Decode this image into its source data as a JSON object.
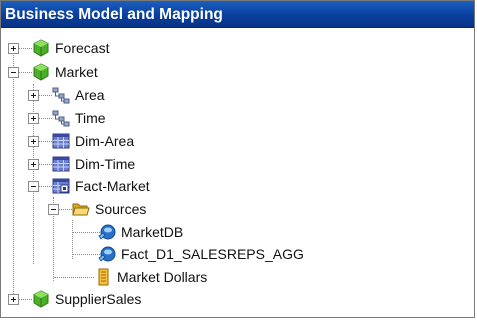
{
  "panel": {
    "title": "Business Model and Mapping"
  },
  "tree": {
    "forecast": "Forecast",
    "market": "Market",
    "area": "Area",
    "time": "Time",
    "dim_area": "Dim-Area",
    "dim_time": "Dim-Time",
    "fact_market": "Fact-Market",
    "sources": "Sources",
    "market_db": "MarketDB",
    "fact_d1": "Fact_D1_SALESREPS_AGG",
    "market_dollars": "Market Dollars",
    "supplier_sales": "SupplierSales"
  },
  "colors": {
    "title_bg": "#0a3f9e",
    "title_text": "#ffffff",
    "model_icon": "#4caf2a",
    "table_icon": "#4a5fb0",
    "folder_icon": "#f2c94c",
    "measure_icon": "#f0a020"
  },
  "icons": {
    "business_model": "green-cube-icon",
    "hierarchy": "hierarchy-icon",
    "dimension_table": "dimension-table-icon",
    "fact_table": "fact-table-icon",
    "folder": "folder-open-icon",
    "source": "logical-table-source-icon",
    "measure": "measure-column-icon"
  }
}
